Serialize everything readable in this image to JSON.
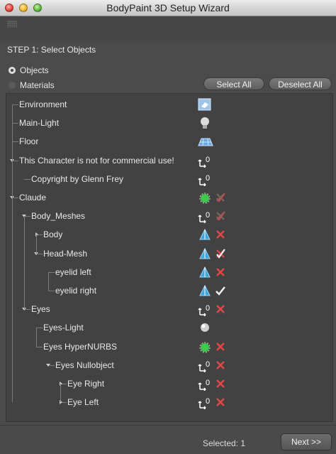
{
  "window": {
    "title": "BodyPaint 3D Setup Wizard"
  },
  "step": {
    "label": "STEP 1: Select Objects"
  },
  "options": {
    "objects_label": "Objects",
    "materials_label": "Materials",
    "selected": "Objects"
  },
  "buttons": {
    "select_all": "Select All",
    "deselect_all": "Deselect All",
    "next": "Next >>"
  },
  "status": {
    "selected_text": "Selected: 1"
  },
  "tree": [
    {
      "name": "Environment",
      "icon": "environment-icon",
      "check": "none"
    },
    {
      "name": "Main-Light",
      "icon": "light-bulb-icon",
      "check": "none"
    },
    {
      "name": "Floor",
      "icon": "floor-icon",
      "check": "none"
    },
    {
      "name": "This Character is not for commercial use!",
      "icon": "null-object-icon",
      "check": "none"
    },
    {
      "name": "Copyright by Glenn Frey",
      "icon": "null-object-icon",
      "check": "none"
    },
    {
      "name": "Claude",
      "icon": "hypernurbs-icon",
      "check": "partial"
    },
    {
      "name": "Body_Meshes",
      "icon": "null-object-icon",
      "check": "partial"
    },
    {
      "name": "Body",
      "icon": "polygon-object-icon",
      "check": "cross"
    },
    {
      "name": "Head-Mesh",
      "icon": "polygon-object-icon",
      "check": "partial-red"
    },
    {
      "name": "eyelid left",
      "icon": "polygon-object-icon",
      "check": "cross"
    },
    {
      "name": "eyelid right",
      "icon": "polygon-object-icon",
      "check": "check"
    },
    {
      "name": "Eyes",
      "icon": "null-object-icon",
      "check": "cross"
    },
    {
      "name": "Eyes-Light",
      "icon": "omni-light-icon",
      "check": "none"
    },
    {
      "name": "Eyes HyperNURBS",
      "icon": "hypernurbs-icon",
      "check": "cross"
    },
    {
      "name": "Eyes Nullobject",
      "icon": "null-object-icon",
      "check": "cross"
    },
    {
      "name": "Eye Right",
      "icon": "null-object-icon",
      "check": "cross"
    },
    {
      "name": "Eye Left",
      "icon": "null-object-icon",
      "check": "cross"
    }
  ],
  "colors": {
    "cross": "#e04848",
    "check": "#f2f2f2",
    "partial": "#b45050",
    "null_icon": "#ffffff",
    "polygon_icon": "#3aa6e0",
    "hypernurbs_icon": "#3fc94a"
  }
}
